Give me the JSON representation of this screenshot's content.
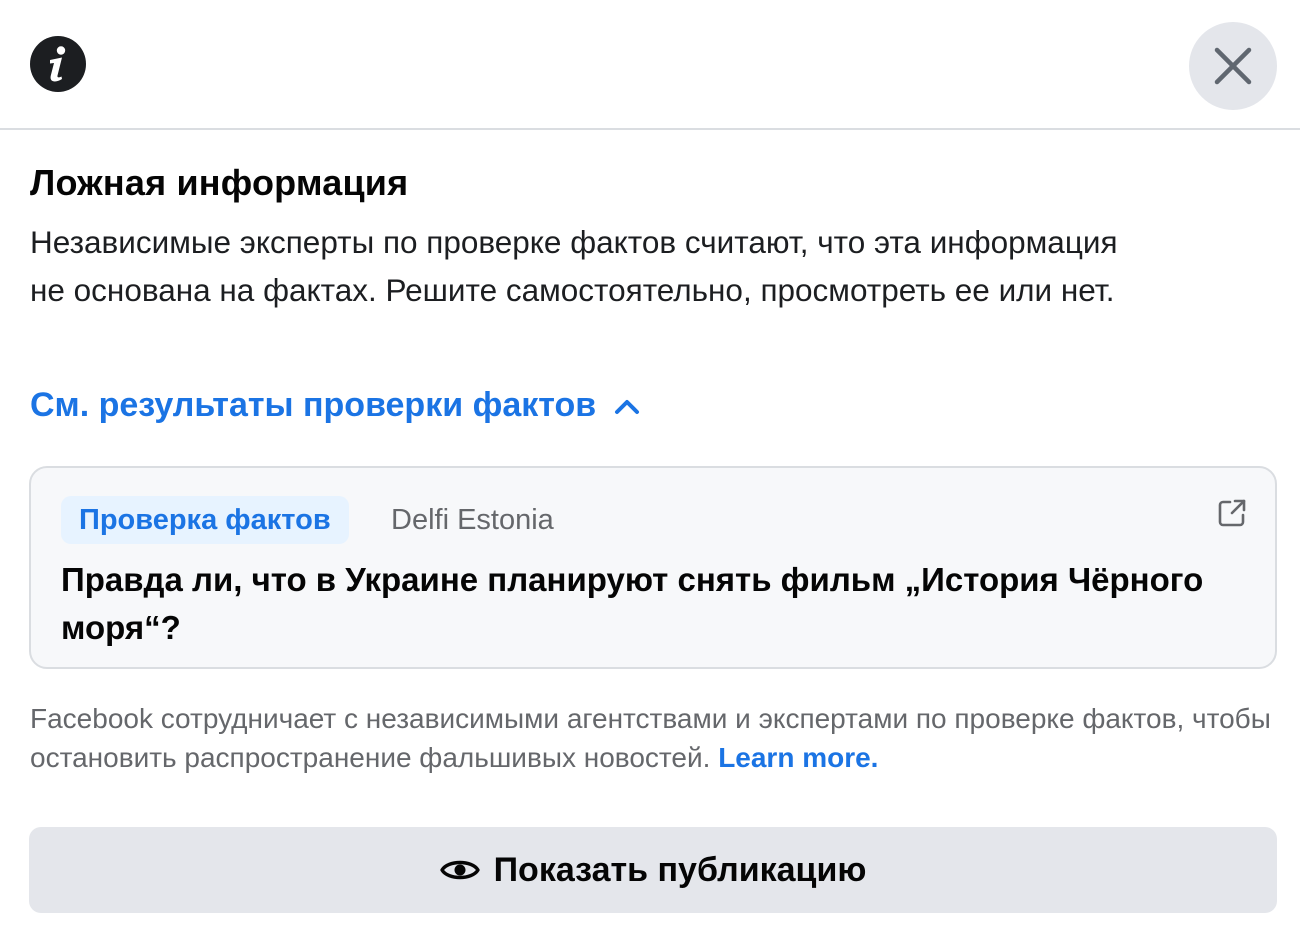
{
  "header": {
    "info_icon": "info-icon",
    "close_icon": "close-icon"
  },
  "warning": {
    "title": "Ложная информация",
    "description": "Независимые эксперты по проверке фактов считают, что эта информация не основана на фактах. Решите самостоятельно, просмотреть ее или нет."
  },
  "fact_check_toggle": {
    "label": "См. результаты проверки фактов",
    "icon": "chevron-up-icon"
  },
  "fact_check_card": {
    "badge": "Проверка фактов",
    "source": "Delfi Estonia",
    "headline": "Правда ли, что в Украине планируют снять фильм „История Чёрного моря“?",
    "external_icon": "external-link-icon"
  },
  "footnote": {
    "text": "Facebook сотрудничает с независимыми агентствами и экспертами по проверке фактов, чтобы остановить распространение фальшивых новостей. ",
    "link": "Learn more."
  },
  "show_post_button": {
    "label": "Показать публикацию",
    "icon": "eye-icon"
  },
  "colors": {
    "link_blue": "#1b74e4",
    "badge_bg": "#e7f3ff",
    "button_bg": "#e4e6eb",
    "secondary_text": "#65676b"
  }
}
